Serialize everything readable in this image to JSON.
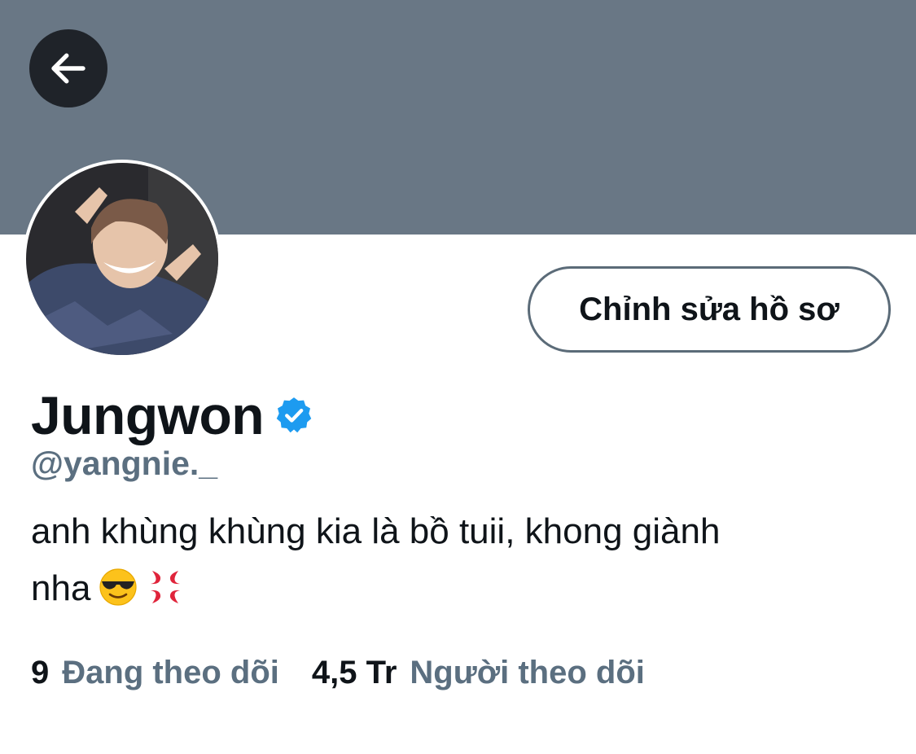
{
  "colors": {
    "banner": "#697785",
    "back_button_bg": "#1f2329",
    "verified_badge": "#1d9bf0",
    "secondary_text": "#5b6f80",
    "primary_text": "#0f1419"
  },
  "header": {
    "back_icon": "arrow-left-icon"
  },
  "profile": {
    "edit_button_label": "Chỉnh sửa hồ sơ",
    "display_name": "Jungwon",
    "verified_icon": "verified-badge-icon",
    "handle": "@yangnie._",
    "bio_line_1": "anh khùng khùng kia là bồ tuii, khong giành",
    "bio_line_2": "nha",
    "bio_emojis": [
      "smiling-face-with-sunglasses-icon",
      "anger-symbol-icon"
    ]
  },
  "stats": {
    "following_count": "9",
    "following_label": "Đang theo dõi",
    "followers_count": "4,5 Tr",
    "followers_label": "Người theo dõi"
  }
}
